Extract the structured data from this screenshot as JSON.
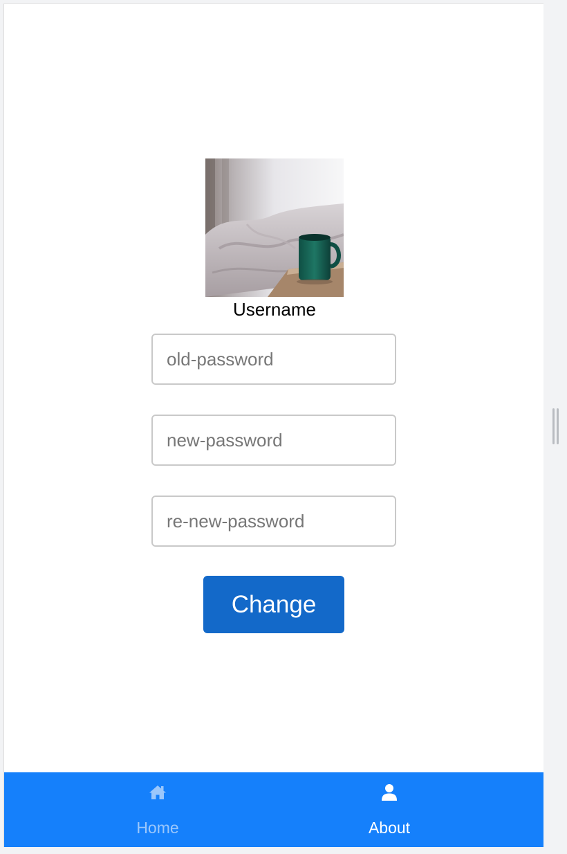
{
  "profile": {
    "username": "Username"
  },
  "form": {
    "old_password_placeholder": "old-password",
    "new_password_placeholder": "new-password",
    "renew_password_placeholder": "re-new-password",
    "change_label": "Change"
  },
  "tabbar": {
    "tabs": [
      {
        "label": "Home",
        "icon": "home-icon",
        "active": false
      },
      {
        "label": "About",
        "icon": "user-icon",
        "active": true
      }
    ]
  },
  "colors": {
    "accent": "#1580fb",
    "button": "#1369c9",
    "inactive_tab": "#9bc7fb",
    "active_tab": "#ffffff"
  }
}
